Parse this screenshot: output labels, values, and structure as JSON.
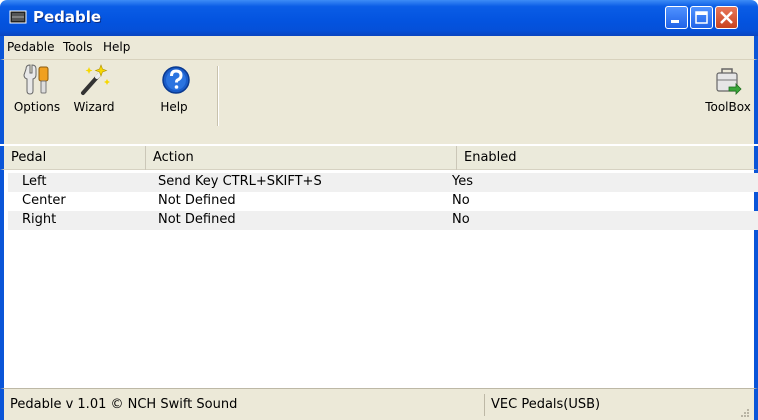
{
  "window": {
    "title": "Pedable",
    "icon": "pedal-icon"
  },
  "menu": {
    "items": [
      "Pedable",
      "Tools",
      "Help"
    ]
  },
  "toolbar": {
    "options_label": "Options",
    "wizard_label": "Wizard",
    "help_label": "Help",
    "toolbox_label": "ToolBox"
  },
  "list": {
    "columns": [
      "Pedal",
      "Action",
      "Enabled"
    ],
    "rows": [
      {
        "pedal": "Left",
        "action": "Send Key CTRL+SKIFT+S",
        "enabled": "Yes"
      },
      {
        "pedal": "Center",
        "action": "Not Defined",
        "enabled": "No"
      },
      {
        "pedal": "Right",
        "action": "Not Defined",
        "enabled": "No"
      }
    ]
  },
  "status": {
    "left": "Pedable v 1.01 © NCH Swift Sound",
    "right": "VEC Pedals(USB)"
  },
  "colors": {
    "titlebar": "#0454e0",
    "chrome": "#ece9d8",
    "close": "#c8431f"
  }
}
